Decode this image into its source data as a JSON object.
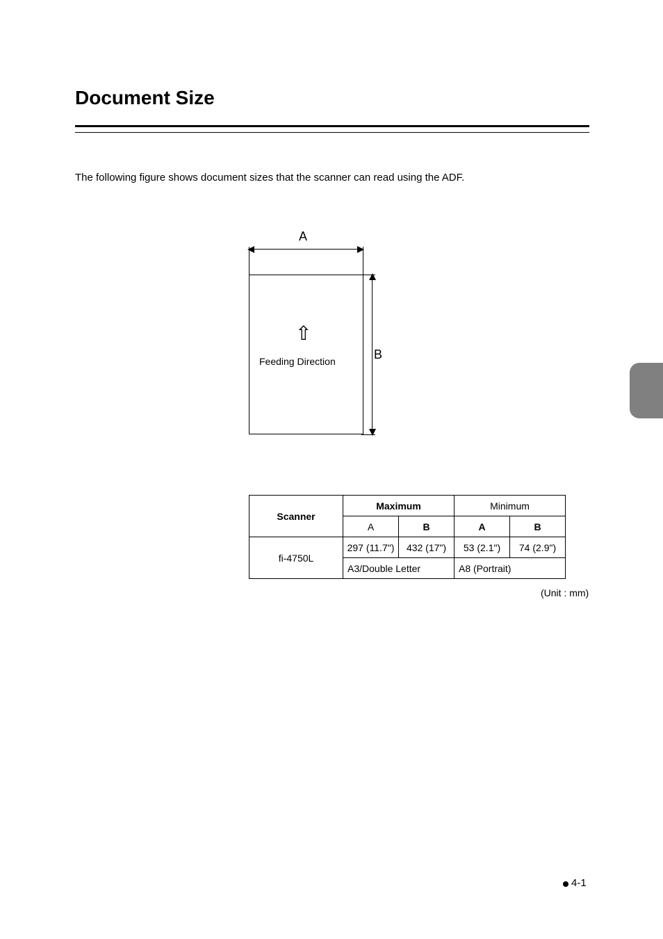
{
  "title": "Document Size",
  "intro": "The following figure shows document sizes that the scanner can read using the ADF.",
  "figure": {
    "dim_a_label": "A",
    "dim_b_label": "B",
    "feed_label": "Feeding Direction",
    "arrow_glyph": "⇧"
  },
  "table": {
    "headers": {
      "scanner": "Scanner",
      "maximum": "Maximum",
      "minimum": "Minimum",
      "a": "A",
      "b": "B"
    },
    "row": {
      "scanner": "fi-4750L",
      "max_a": "297 (11.7\")",
      "max_b": "432 (17\")",
      "min_a": "53 (2.1\")",
      "min_b": "74 (2.9\")",
      "max_name": "A3/Double Letter",
      "min_name": "A8 (Portrait)"
    },
    "unit": "(Unit : mm)"
  },
  "footer": {
    "page": "4-1"
  }
}
